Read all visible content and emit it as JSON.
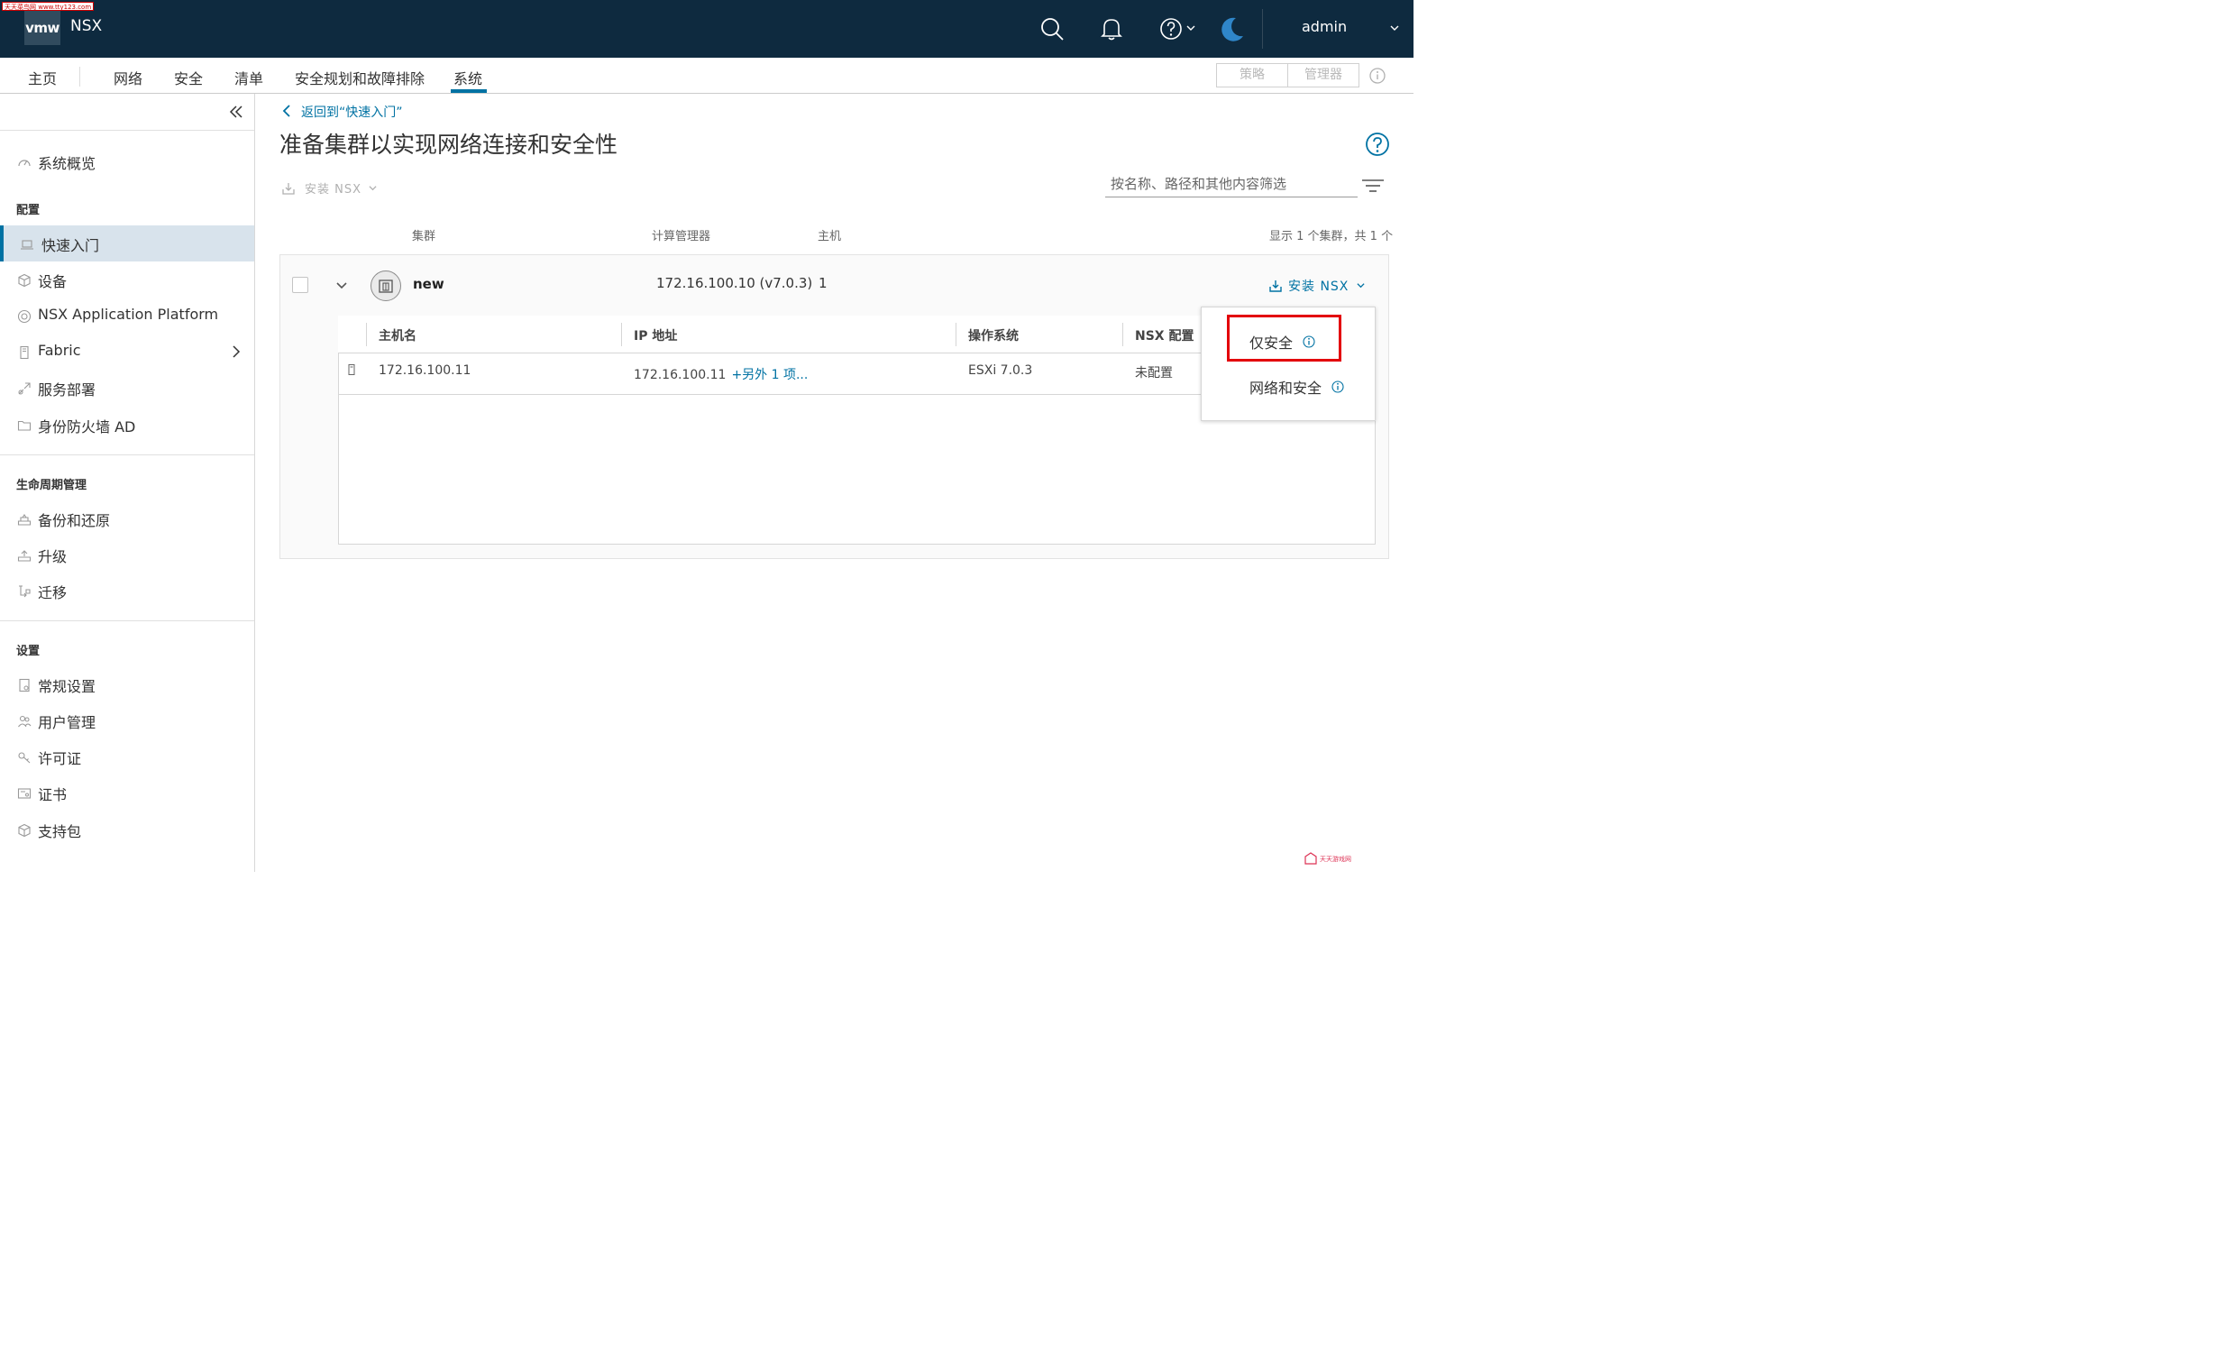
{
  "watermark": {
    "top_left": "天天菜鸟网 www.tty123.com",
    "bottom_right": "天天游戏网"
  },
  "header": {
    "logo": "vmw",
    "product": "NSX",
    "user": "admin",
    "icons": [
      "search-icon",
      "bell-icon",
      "help-icon",
      "moon-icon"
    ]
  },
  "nav": {
    "items": [
      "主页",
      "网络",
      "安全",
      "清单",
      "安全规划和故障排除",
      "系统"
    ],
    "active": "系统",
    "segment": [
      "策略",
      "管理器"
    ]
  },
  "sidebar": {
    "overview": "系统概览",
    "sections": {
      "config": "配置",
      "lifecycle": "生命周期管理",
      "settings": "设置"
    },
    "config_items": [
      "快速入门",
      "设备",
      "NSX Application Platform",
      "Fabric",
      "服务部署",
      "身份防火墙 AD"
    ],
    "lifecycle_items": [
      "备份和还原",
      "升级",
      "迁移"
    ],
    "settings_items": [
      "常规设置",
      "用户管理",
      "许可证",
      "证书",
      "支持包"
    ],
    "active": "快速入门"
  },
  "main": {
    "back_link": "返回到“快速入门”",
    "title": "准备集群以实现网络连接和安全性",
    "install_label": "安装 NSX",
    "filter_placeholder": "按名称、路径和其他内容筛选",
    "columns": [
      "集群",
      "计算管理器",
      "主机"
    ],
    "count_text": "显示 1 个集群，共 1 个",
    "cluster": {
      "name": "new",
      "manager": "172.16.100.10 (v7.0.3)",
      "hosts": "1",
      "install_button": "安装 NSX"
    },
    "host_table": {
      "headers": [
        "主机名",
        "IP 地址",
        "操作系统",
        "NSX 配置"
      ],
      "rows": [
        {
          "hostname": "172.16.100.11",
          "ip": "172.16.100.11",
          "ip_more": "+另外 1 项...",
          "os": "ESXi 7.0.3",
          "nsx_config": "未配置"
        }
      ]
    }
  },
  "dropdown": {
    "items": [
      "仅安全",
      "网络和安全"
    ],
    "highlighted": "仅安全"
  },
  "colors": {
    "header_bg": "#0e2a3f",
    "accent": "#0072a3",
    "highlight": "#e3000b"
  }
}
